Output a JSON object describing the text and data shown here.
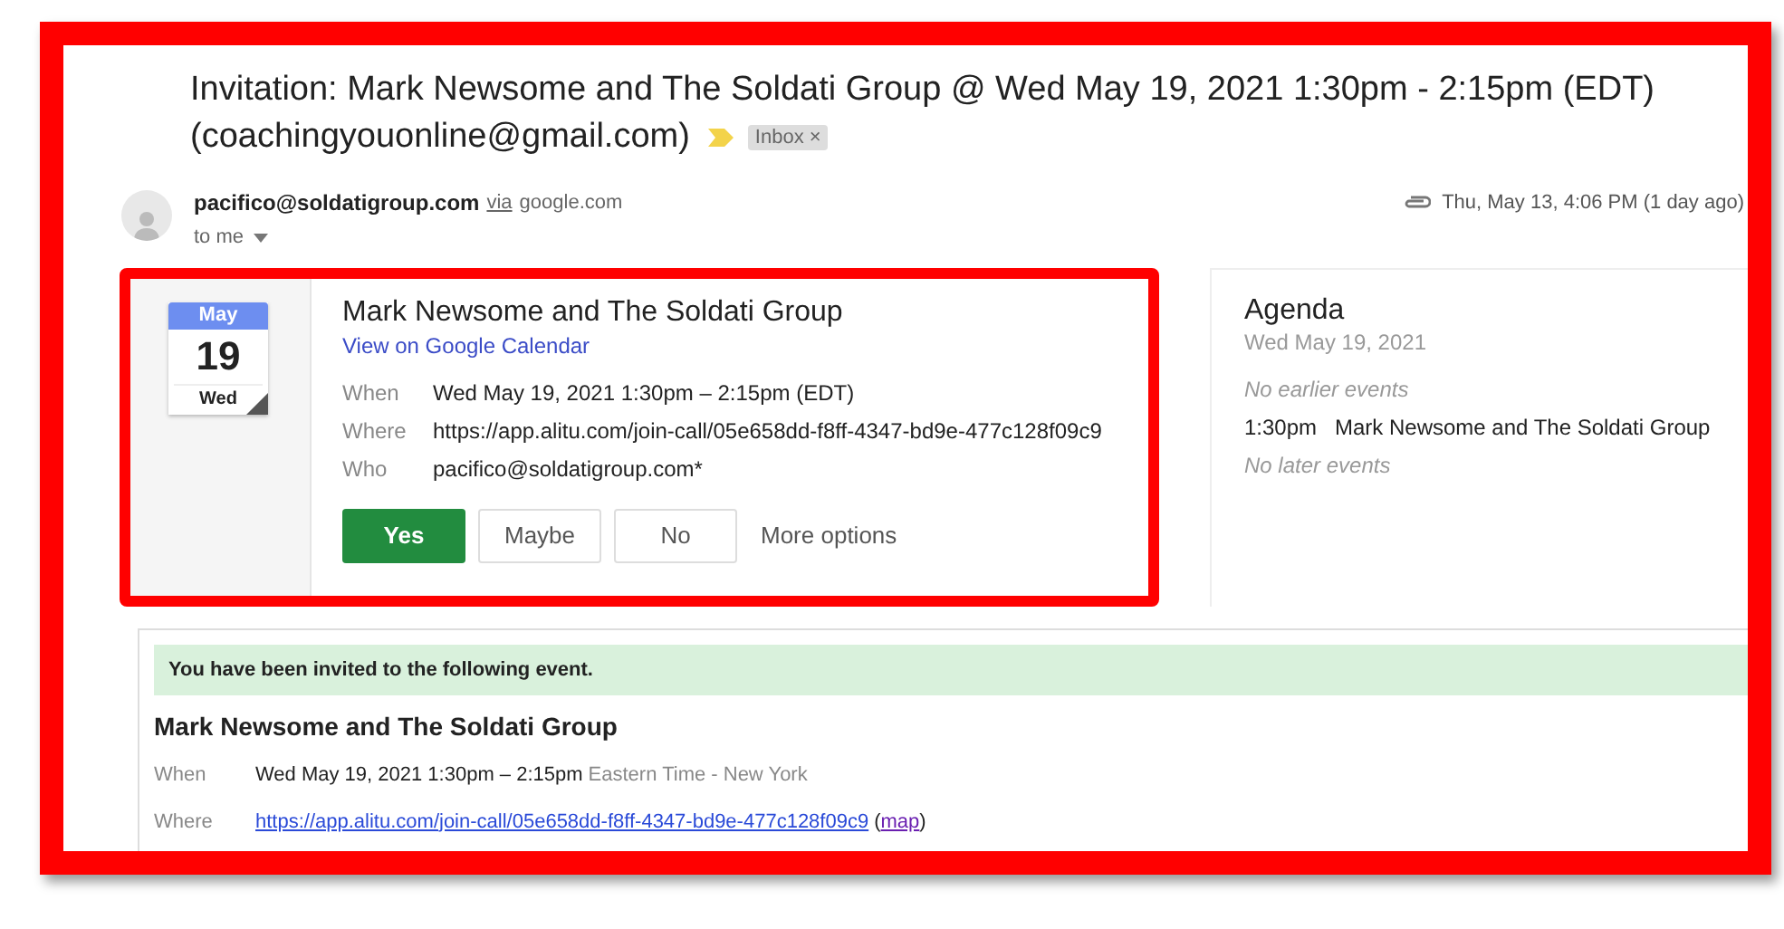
{
  "subject": {
    "text": "Invitation: Mark Newsome and The Soldati Group @ Wed May 19, 2021 1:30pm - 2:15pm (EDT)",
    "recipient": "(coachingyouonline@gmail.com)",
    "important": true,
    "label": "Inbox",
    "label_close": "×"
  },
  "sender": {
    "email": "pacifico@soldatigroup.com",
    "via": "via",
    "domain": "google.com",
    "to": "to me",
    "date": "Thu, May 13, 4:06 PM (1 day ago)",
    "attachment": true
  },
  "calendar": {
    "month": "May",
    "day": "19",
    "weekday": "Wed"
  },
  "event": {
    "title": "Mark Newsome and The Soldati Group",
    "link": "View on Google Calendar",
    "details": [
      {
        "label": "When",
        "value": "Wed May 19, 2021 1:30pm – 2:15pm (EDT)"
      },
      {
        "label": "Where",
        "value": "https://app.alitu.com/join-call/05e658dd-f8ff-4347-bd9e-477c128f09c9"
      },
      {
        "label": "Who",
        "value": "pacifico@soldatigroup.com*"
      }
    ],
    "rsvp": [
      {
        "label": "Yes",
        "selected": true
      },
      {
        "label": "Maybe",
        "selected": false
      },
      {
        "label": "No",
        "selected": false
      }
    ],
    "more": "More options"
  },
  "agenda": {
    "title": "Agenda",
    "date": "Wed May 19, 2021",
    "items": [
      {
        "kind": "note",
        "text": "No earlier events"
      },
      {
        "kind": "event",
        "time": "1:30pm",
        "text": "Mark Newsome and The Soldati Group"
      },
      {
        "kind": "note",
        "text": "No later events"
      }
    ]
  },
  "invite": {
    "banner": "You have been invited to the following event.",
    "title": "Mark Newsome and The Soldati Group",
    "when_label": "When",
    "when": "Wed May 19, 2021 1:30pm – 2:15pm",
    "timezone": "Eastern Time - New York",
    "where_label": "Where",
    "where": "https://app.alitu.com/join-call/05e658dd-f8ff-4347-bd9e-477c128f09c9",
    "map_open": "(",
    "map": "map",
    "map_close": ")"
  }
}
